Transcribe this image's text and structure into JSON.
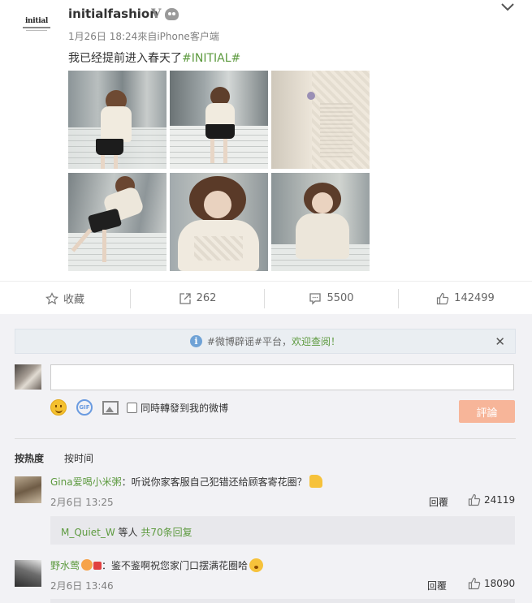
{
  "post": {
    "username": "initialfashion",
    "verified_badge": "V",
    "logo_text": "initial",
    "time": "1月26日 18:24",
    "source": "來自iPhone客户端",
    "text_prefix": "我已经提前进入春天了",
    "hashtag": "#INITIAL#",
    "photos": [
      {
        "name": "photo-1",
        "palette": [
          "#8a9295",
          "#d9dcda",
          "#efe9dd",
          "#1c1c1c"
        ]
      },
      {
        "name": "photo-2",
        "palette": [
          "#6d7577",
          "#dcdedc",
          "#f1ebdf",
          "#1b1b1b"
        ]
      },
      {
        "name": "photo-3",
        "palette": [
          "#efe8dc",
          "#e2dccf",
          "#b7b2a8",
          "#9a8fb5"
        ]
      },
      {
        "name": "photo-4",
        "palette": [
          "#7c8487",
          "#d8dbd8",
          "#ede7db",
          "#1f1f1f"
        ]
      },
      {
        "name": "photo-5",
        "palette": [
          "#9aa3a6",
          "#c7c9c4",
          "#f0eadf",
          "#5a3a28"
        ]
      },
      {
        "name": "photo-6",
        "palette": [
          "#8c9597",
          "#cfd3cf",
          "#ece6da",
          "#5c3d2b"
        ]
      }
    ]
  },
  "actions": {
    "favorite_label": "收藏",
    "repost_count": "262",
    "comment_count": "5500",
    "like_count": "142499"
  },
  "notice": {
    "hashtag": "#微博辟谣#平台，",
    "link": "欢迎查阅！"
  },
  "composer": {
    "placeholder": "",
    "repost_checkbox_label": "同時轉發到我的微博",
    "submit_label": "評論"
  },
  "sort": {
    "hot": "按热度",
    "time": "按时间"
  },
  "comments": [
    {
      "name": "Gina爱喝小米粥",
      "text": "：听说你家客服自己犯错还给顾客寄花圈？",
      "time": "2月6日 13:25",
      "reply_label": "回覆",
      "likes": "24119",
      "sub_user": "M_Quiet_W",
      "sub_mid": " 等人 ",
      "sub_count": "共70条回复"
    },
    {
      "name": "野水莺",
      "text": "：鉴不鉴啊祝您家门口摆满花圈哈",
      "time": "2月6日 13:46",
      "reply_label": "回覆",
      "likes": "18090"
    }
  ],
  "colors": {
    "link_green": "#5d9a3f",
    "submit_bg": "#f7b599",
    "page_bg": "#f2f2f5"
  }
}
